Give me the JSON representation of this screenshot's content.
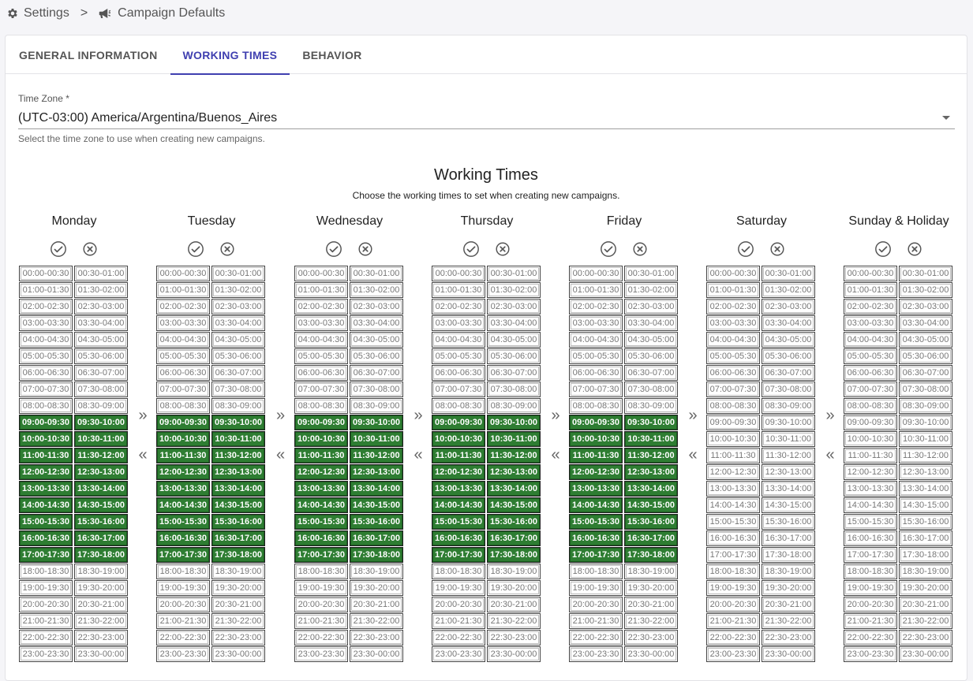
{
  "breadcrumb": {
    "root_icon": "gear-icon",
    "root": "Settings",
    "separator": ">",
    "current_icon": "megaphone-icon",
    "current": "Campaign Defaults"
  },
  "tabs": [
    {
      "label": "GENERAL INFORMATION",
      "active": false
    },
    {
      "label": "WORKING TIMES",
      "active": true
    },
    {
      "label": "BEHAVIOR",
      "active": false
    }
  ],
  "timezone": {
    "label": "Time Zone *",
    "value": "(UTC-03:00) America/Argentina/Buenos_Aires",
    "help": "Select the time zone to use when creating new campaigns."
  },
  "working_times": {
    "title": "Working Times",
    "subtitle": "Choose the working times to set when creating new campaigns.",
    "copy_forward_symbol": "»",
    "copy_back_symbol": "«",
    "select_all_icon": "check-circle-icon",
    "clear_all_icon": "cancel-circle-icon",
    "slots": [
      "00:00-00:30",
      "00:30-01:00",
      "01:00-01:30",
      "01:30-02:00",
      "02:00-02:30",
      "02:30-03:00",
      "03:00-03:30",
      "03:30-04:00",
      "04:00-04:30",
      "04:30-05:00",
      "05:00-05:30",
      "05:30-06:00",
      "06:00-06:30",
      "06:30-07:00",
      "07:00-07:30",
      "07:30-08:00",
      "08:00-08:30",
      "08:30-09:00",
      "09:00-09:30",
      "09:30-10:00",
      "10:00-10:30",
      "10:30-11:00",
      "11:00-11:30",
      "11:30-12:00",
      "12:00-12:30",
      "12:30-13:00",
      "13:00-13:30",
      "13:30-14:00",
      "14:00-14:30",
      "14:30-15:00",
      "15:00-15:30",
      "15:30-16:00",
      "16:00-16:30",
      "16:30-17:00",
      "17:00-17:30",
      "17:30-18:00",
      "18:00-18:30",
      "18:30-19:00",
      "19:00-19:30",
      "19:30-20:00",
      "20:00-20:30",
      "20:30-21:00",
      "21:00-21:30",
      "21:30-22:00",
      "22:00-22:30",
      "22:30-23:00",
      "23:00-23:30",
      "23:30-00:00"
    ],
    "days": [
      {
        "name": "Monday",
        "active_from": 18,
        "active_to": 35
      },
      {
        "name": "Tuesday",
        "active_from": 18,
        "active_to": 35
      },
      {
        "name": "Wednesday",
        "active_from": 18,
        "active_to": 35
      },
      {
        "name": "Thursday",
        "active_from": 18,
        "active_to": 35
      },
      {
        "name": "Friday",
        "active_from": 18,
        "active_to": 35
      },
      {
        "name": "Saturday",
        "active_from": -1,
        "active_to": -1
      },
      {
        "name": "Sunday & Holiday",
        "active_from": -1,
        "active_to": -1
      }
    ]
  },
  "colors": {
    "accent": "#3f3fb0",
    "active_slot": "#2e7d32"
  }
}
